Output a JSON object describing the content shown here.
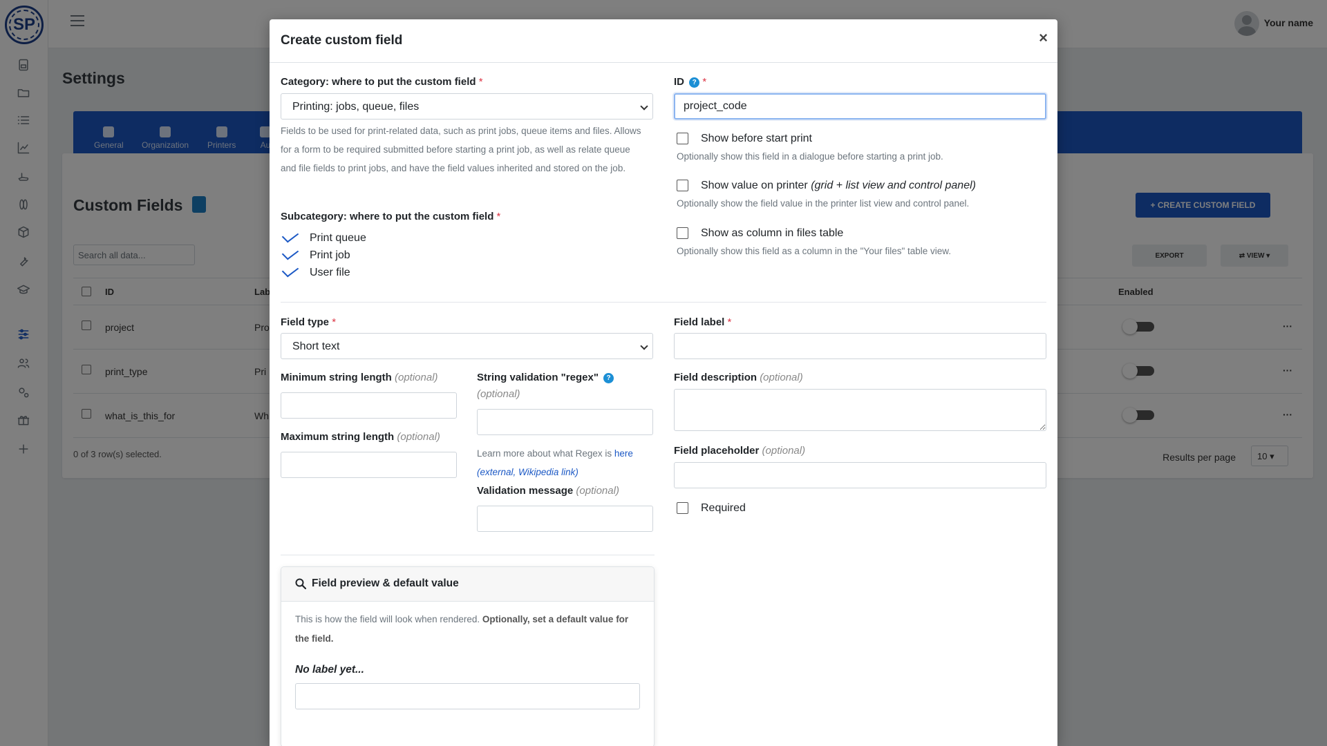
{
  "app": {
    "logo_text": "SP",
    "user_name": "Your name",
    "page_title": "Settings",
    "tabs": [
      {
        "label": "General"
      },
      {
        "label": "Organization"
      },
      {
        "label": "Printers"
      },
      {
        "label": "Au"
      }
    ],
    "custom_fields": {
      "title": "Custom Fields",
      "search_placeholder": "Search all data...",
      "create_button": "CREATE CUSTOM FIELD",
      "export_button": "EXPORT",
      "view_button": "VIEW",
      "columns": [
        "ID",
        "Lab",
        "Enabled"
      ],
      "rows": [
        {
          "id": "project",
          "label": "Pro"
        },
        {
          "id": "print_type",
          "label": "Pri"
        },
        {
          "id": "what_is_this_for",
          "label": "Wh"
        }
      ],
      "selection_text": "0 of 3 row(s) selected.",
      "results_per_page_label": "Results per page",
      "results_per_page_value": "10"
    }
  },
  "modal": {
    "title": "Create custom field",
    "close_glyph": "×",
    "category": {
      "label": "Category: where to put the custom field",
      "value": "Printing: jobs, queue, files",
      "help": "Fields to be used for print-related data, such as print jobs, queue items and files. Allows for a form to be required submitted before starting a print job, as well as relate queue and file fields to print jobs, and have the field values inherited and stored on the job."
    },
    "subcategory": {
      "label": "Subcategory: where to put the custom field",
      "items": [
        "Print queue",
        "Print job",
        "User file"
      ]
    },
    "id_field": {
      "label": "ID",
      "value": "project_code"
    },
    "options": [
      {
        "label": "Show before start print",
        "label_extra": "",
        "help": "Optionally show this field in a dialogue before starting a print job."
      },
      {
        "label": "Show value on printer ",
        "label_extra": "(grid + list view and control panel)",
        "help": "Optionally show the field value in the printer list view and control panel."
      },
      {
        "label": "Show as column in files table",
        "label_extra": "",
        "help": "Optionally show this field as a column in the \"Your files\" table view."
      }
    ],
    "field_type": {
      "label": "Field type",
      "value": "Short text"
    },
    "min_length": {
      "label": "Minimum string length",
      "optional": "(optional)"
    },
    "max_length": {
      "label": "Maximum string length",
      "optional": "(optional)"
    },
    "regex": {
      "label": "String validation \"regex\"",
      "optional": "(optional)",
      "help_prefix": "Learn more about what Regex is ",
      "help_link": "here",
      "help_link_extra": "(external, Wikipedia link)"
    },
    "validation_message": {
      "label": "Validation message",
      "optional": "(optional)"
    },
    "field_label": {
      "label": "Field label"
    },
    "field_description": {
      "label": "Field description",
      "optional": "(optional)"
    },
    "field_placeholder": {
      "label": "Field placeholder",
      "optional": "(optional)"
    },
    "required": {
      "label": "Required"
    },
    "preview": {
      "title": "Field preview & default value",
      "desc_plain": "This is how the field will look when rendered. ",
      "desc_bold": "Optionally, set a default value for the field.",
      "no_label": "No label yet..."
    },
    "help_glyph": "?",
    "required_marker": "*"
  },
  "colors": {
    "accent": "#1c59c5",
    "required": "#dc3545",
    "help": "#1c8fd5",
    "overlay": "rgba(0,0,0,0.5)"
  }
}
